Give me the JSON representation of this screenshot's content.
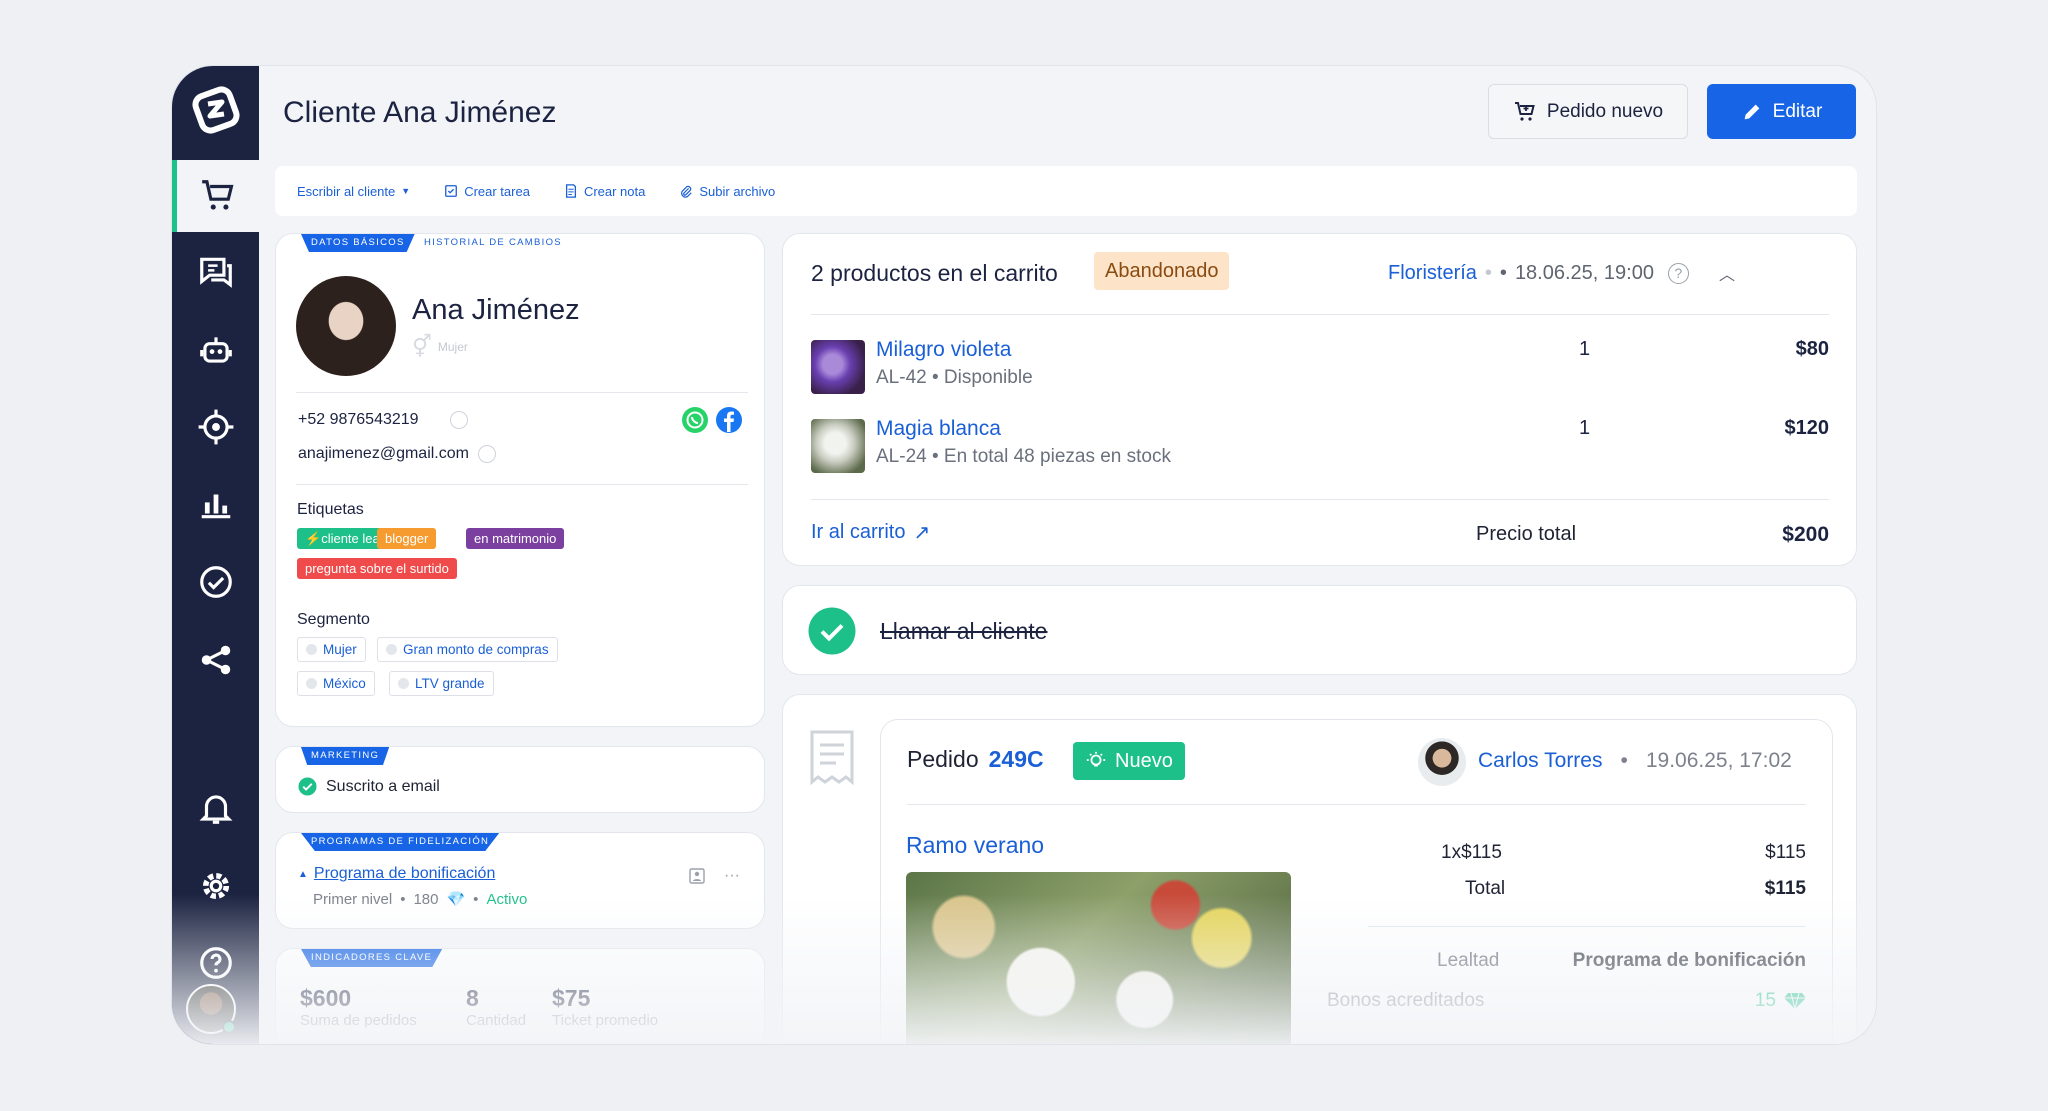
{
  "page": {
    "title": "Cliente Ana Jiménez"
  },
  "header": {
    "new_order_label": "Pedido nuevo",
    "edit_label": "Editar"
  },
  "actions": {
    "write": "Escribir al cliente",
    "task": "Crear tarea",
    "note": "Crear nota",
    "upload": "Subir archivo"
  },
  "nav_icons": [
    "cart-icon",
    "chat-icon",
    "bot-icon",
    "target-icon",
    "chart-icon",
    "check-circle-icon",
    "share-icon",
    "bell-icon",
    "gear-icon",
    "help-icon"
  ],
  "colors": {
    "sidebar": "#1c2341",
    "accent": "#1765e6",
    "success": "#1ec08a",
    "abandoned_bg": "#fde4c8"
  },
  "client": {
    "tab_basic": "DATOS BÁSICOS",
    "tab_history": "HISTORIAL DE CAMBIOS",
    "name": "Ana Jiménez",
    "gender": "Mujer",
    "phone": "+52 9876543219",
    "email": "anajimenez@gmail.com",
    "tags_label": "Etiquetas",
    "tags": [
      {
        "label": "cliente leal",
        "color": "#1ec08a"
      },
      {
        "label": "blogger",
        "color": "#f59b2f"
      },
      {
        "label": "en matrimonio",
        "color": "#7b3fa0"
      },
      {
        "label": "pregunta sobre el surtido",
        "color": "#ef4b4b"
      }
    ],
    "segment_label": "Segmento",
    "segments": [
      "Mujer",
      "Gran monto de compras",
      "México",
      "LTV grande"
    ]
  },
  "marketing": {
    "tab": "MARKETING",
    "status": "Suscrito a email"
  },
  "loyalty": {
    "tab": "PROGRAMAS DE FIDELIZACIÓN",
    "program": "Programa de bonificación",
    "level": "Primer nivel",
    "points": "180",
    "status": "Activo"
  },
  "kpi": {
    "tab": "INDICADORES CLAVE",
    "items": [
      {
        "value": "$600",
        "label": "Suma de pedidos"
      },
      {
        "value": "8",
        "label": "Cantidad"
      },
      {
        "value": "$75",
        "label": "Ticket promedio"
      }
    ]
  },
  "cart": {
    "title": "2 productos en el carrito",
    "status": "Abandonado",
    "store": "Floristería",
    "date": "18.06.25, 19:00",
    "items": [
      {
        "name": "Milagro violeta",
        "sub": "AL-42 • Disponible",
        "qty": "1",
        "price": "$80"
      },
      {
        "name": "Magia blanca",
        "sub": "AL-24 • En total 48 piezas en stock",
        "qty": "1",
        "price": "$120"
      }
    ],
    "link": "Ir al carrito",
    "total_label": "Precio total",
    "total": "$200"
  },
  "task": {
    "title": "Llamar al cliente"
  },
  "order": {
    "label": "Pedido",
    "number": "249C",
    "status": "Nuevo",
    "manager": "Carlos Torres",
    "date": "19.06.25, 17:02",
    "product": "Ramo verano",
    "qty_price": "1x$115",
    "line_total": "$115",
    "total_label": "Total",
    "total": "$115",
    "loyalty_label": "Lealtad",
    "loyalty_value": "Programa de bonificación",
    "bonus_label": "Bonos acreditados",
    "bonus_value": "15"
  }
}
